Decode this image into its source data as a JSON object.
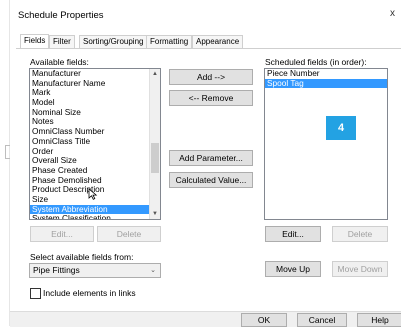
{
  "dialog": {
    "title": "Schedule Properties",
    "close_glyph": "x"
  },
  "tabs": [
    {
      "label": "Fields"
    },
    {
      "label": "Filter"
    },
    {
      "label": "Sorting/Grouping"
    },
    {
      "label": "Formatting"
    },
    {
      "label": "Appearance"
    }
  ],
  "available": {
    "label": "Available fields:",
    "items": [
      "Manufacturer",
      "Manufacturer Name",
      "Mark",
      "Model",
      "Nominal Size",
      "Notes",
      "OmniClass Number",
      "OmniClass Title",
      "Order",
      "Overall Size",
      "Phase Created",
      "Phase Demolished",
      "Product Description",
      "Size",
      "System Abbreviation",
      "System Classification"
    ],
    "selected_index": 14
  },
  "scheduled": {
    "label": "Scheduled fields (in order):",
    "items": [
      "Piece Number",
      "Spool Tag"
    ],
    "selected_index": 1
  },
  "buttons": {
    "add": "Add -->",
    "remove": "<-- Remove",
    "add_parameter": "Add Parameter...",
    "calculated_value": "Calculated Value...",
    "edit_left": "Edit...",
    "delete_left": "Delete",
    "edit_right": "Edit...",
    "delete_right": "Delete",
    "move_up": "Move Up",
    "move_down": "Move Down",
    "ok": "OK",
    "cancel": "Cancel",
    "help": "Help"
  },
  "select_from": {
    "label": "Select available fields from:",
    "value": "Pipe Fittings"
  },
  "include_links": {
    "label": "Include elements in links",
    "checked": false
  },
  "badge": {
    "text": "4",
    "color": "#23a2e3"
  }
}
